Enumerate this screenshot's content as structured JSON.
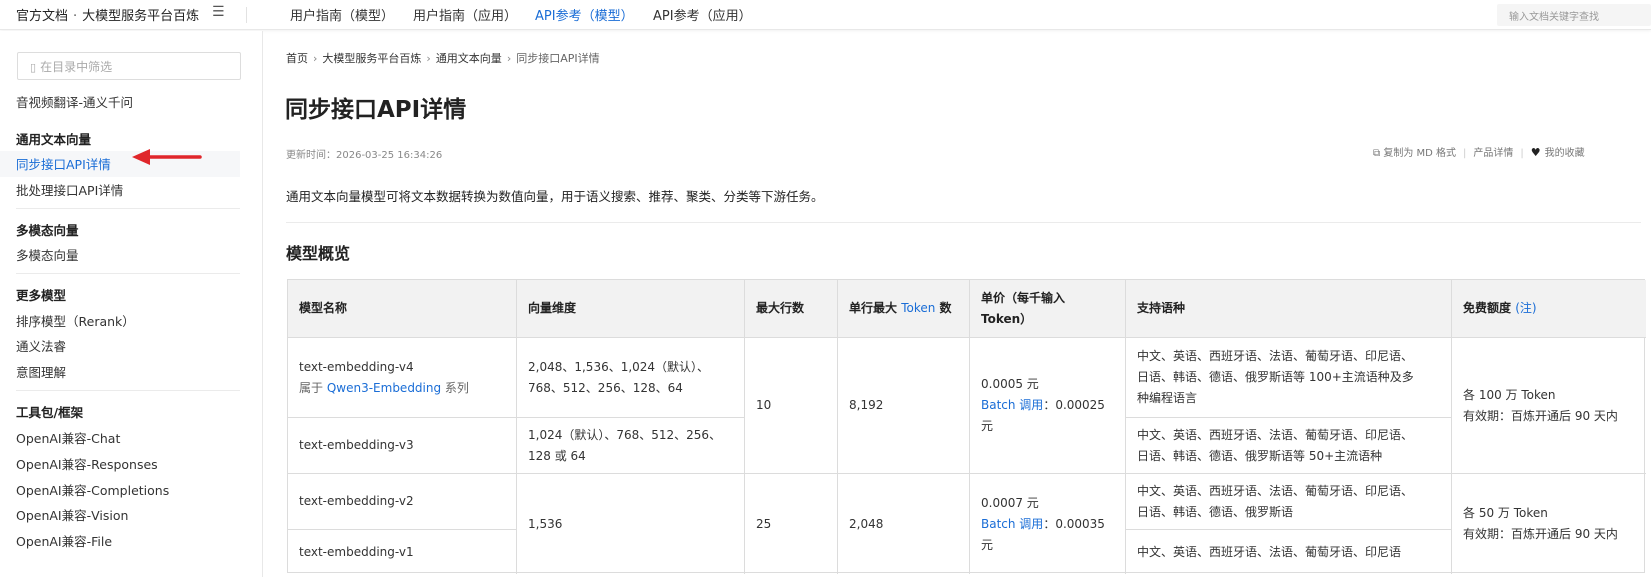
{
  "colors": {
    "accent": "#1a6dd6",
    "arrow": "#e0262b"
  },
  "topbar": {
    "site": "官方文档",
    "dot": "·",
    "product": "大模型服务平台百炼",
    "menu_icon": "menu-icon",
    "nav": [
      "用户指南（模型）",
      "用户指南（应用）",
      "API参考（模型）",
      "API参考（应用）"
    ],
    "nav_active_index": 2,
    "search_placeholder": "输入文档关键字查找"
  },
  "sidebar": {
    "filter_placeholder": "在目录中筛选",
    "truncated_item": "音视频翻译-通义千问",
    "sections": [
      {
        "heading": "通用文本向量",
        "items": [
          "同步接口API详情",
          "批处理接口API详情"
        ]
      },
      {
        "heading": "多模态向量",
        "items": [
          "多模态向量"
        ]
      },
      {
        "heading": "更多模型",
        "items": [
          "排序模型（Rerank）",
          "通义法睿",
          "意图理解"
        ]
      },
      {
        "heading": "工具包/框架",
        "items": [
          "OpenAI兼容-Chat",
          "OpenAI兼容-Responses",
          "OpenAI兼容-Completions",
          "OpenAI兼容-Vision",
          "OpenAI兼容-File"
        ]
      }
    ],
    "active_item": "同步接口API详情"
  },
  "breadcrumb": [
    "首页",
    "大模型服务平台百炼",
    "通用文本向量",
    "同步接口API详情"
  ],
  "page": {
    "title": "同步接口API详情",
    "updated": "更新时间：2026-03-25 16:34:26",
    "actions": {
      "copy_md": "复制为 MD 格式",
      "product_detail": "产品详情",
      "favorites": "我的收藏"
    },
    "description": "通用文本向量模型可将文本数据转换为数值向量，用于语义搜索、推荐、聚类、分类等下游任务。",
    "section_title": "模型概览"
  },
  "table": {
    "headers": {
      "model": "模型名称",
      "dims": "向量维度",
      "max_rows": "最大行数",
      "max_tokens_pre": "单行最大 ",
      "max_tokens_link": "Token",
      "max_tokens_post": " 数",
      "price_1": "单价（每千输入",
      "price_2": "Token）",
      "langs": "支持语种",
      "quota_pre": "免费额度",
      "quota_link": "(注)"
    },
    "rows": {
      "v4_name": "text-embedding-v4",
      "v4_sub_pre": "属于 ",
      "v4_sub_link": "Qwen3-Embedding",
      "v4_sub_post": " 系列",
      "v4_dims_1": "2,048、1,536、1,024（默认）、",
      "v4_dims_2": "768、512、256、128、64",
      "v4_langs_1": "中文、英语、西班牙语、法语、葡萄牙语、印尼语、",
      "v4_langs_2": "日语、韩语、德语、俄罗斯语等 100+主流语种及多",
      "v4_langs_3": "种编程语言",
      "v3_name": "text-embedding-v3",
      "v3_dims_1": "1,024（默认）、768、512、256、",
      "v3_dims_2": "128 或 64",
      "v3_langs_1": "中文、英语、西班牙语、法语、葡萄牙语、印尼语、",
      "v3_langs_2": "日语、韩语、德语、俄罗斯语等 50+主流语种",
      "g1_rows": "10",
      "g1_tokens": "8,192",
      "g1_price": "0.0005 元",
      "g1_batch_link": "Batch 调用",
      "g1_batch_val": "：0.00025",
      "g1_batch_unit": "元",
      "g1_quota_1": "各 100 万 Token",
      "g1_quota_2": "有效期：百炼开通后 90 天内",
      "v2_name": "text-embedding-v2",
      "v2_langs_1": "中文、英语、西班牙语、法语、葡萄牙语、印尼语、",
      "v2_langs_2": "日语、韩语、德语、俄罗斯语",
      "v1_name": "text-embedding-v1",
      "v1_langs_1": "中文、英语、西班牙语、法语、葡萄牙语、印尼语",
      "g2_dims": "1,536",
      "g2_rows": "25",
      "g2_tokens": "2,048",
      "g2_price": "0.0007 元",
      "g2_batch_link": "Batch 调用",
      "g2_batch_val": "：0.00035",
      "g2_batch_unit": "元",
      "g2_quota_1": "各 50 万 Token",
      "g2_quota_2": "有效期：百炼开通后 90 天内"
    }
  }
}
